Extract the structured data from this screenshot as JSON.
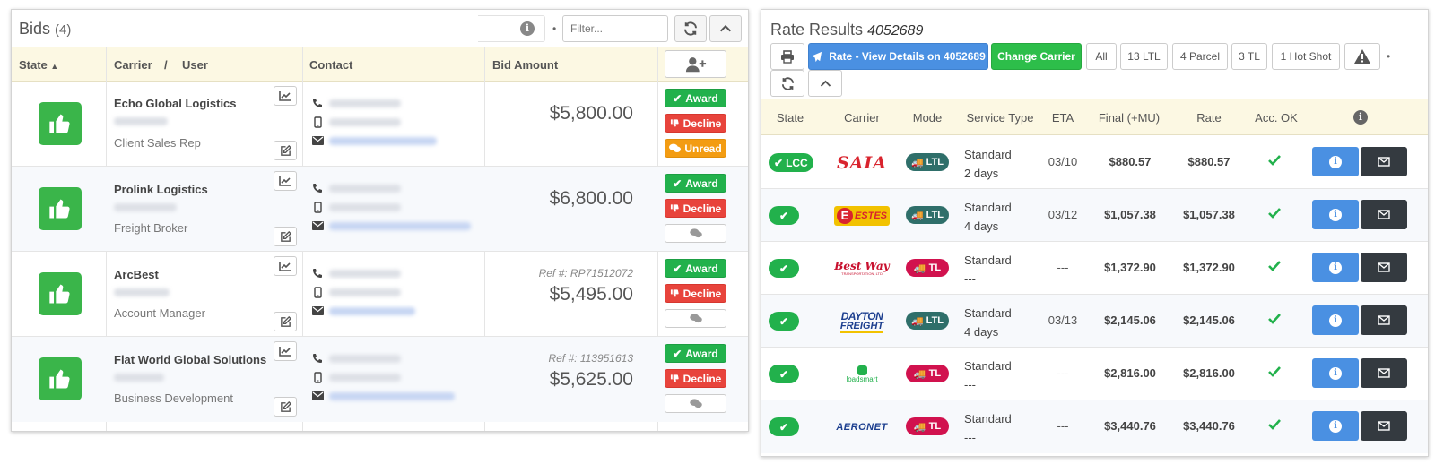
{
  "bids": {
    "title": "Bids",
    "count": "(4)",
    "filter_placeholder": "Filter...",
    "columns": {
      "state": "State",
      "carrier": "Carrier",
      "separator": "/",
      "user": "User",
      "contact": "Contact",
      "bid_amount": "Bid Amount"
    },
    "rows": [
      {
        "carrier": "Echo Global Logistics",
        "role": "Client Sales Rep",
        "ref": "",
        "amount": "$5,800.00",
        "actions": [
          "Award",
          "Decline",
          "Unread"
        ]
      },
      {
        "carrier": "Prolink Logistics",
        "role": "Freight Broker",
        "ref": "",
        "amount": "$6,800.00",
        "actions": [
          "Award",
          "Decline"
        ]
      },
      {
        "carrier": "ArcBest",
        "role": "Account Manager",
        "ref": "Ref #: RP71512072",
        "amount": "$5,495.00",
        "actions": [
          "Award",
          "Decline"
        ]
      },
      {
        "carrier": "Flat World Global Solutions",
        "role": "Business Development",
        "ref": "Ref #: 113951613",
        "amount": "$5,625.00",
        "actions": [
          "Award",
          "Decline"
        ]
      }
    ]
  },
  "rates": {
    "title": "Rate Results",
    "quote_id": "4052689",
    "buttons": {
      "view_details": "Rate - View Details on 4052689",
      "change_carrier": "Change Carrier",
      "filters": [
        "All",
        "13 LTL",
        "4 Parcel",
        "3 TL",
        "1 Hot Shot"
      ]
    },
    "columns": {
      "state": "State",
      "carrier": "Carrier",
      "mode": "Mode",
      "service_type": "Service Type",
      "eta": "ETA",
      "final": "Final (+MU)",
      "rate": "Rate",
      "acc_ok": "Acc. OK"
    },
    "rows": [
      {
        "state": "LCC",
        "carrier": "SAIA",
        "mode": "LTL",
        "service": "Standard",
        "days": "2 days",
        "eta": "03/10",
        "final": "$880.57",
        "rate": "$880.57"
      },
      {
        "state": "",
        "carrier": "ESTES",
        "mode": "LTL",
        "service": "Standard",
        "days": "4 days",
        "eta": "03/12",
        "final": "$1,057.38",
        "rate": "$1,057.38"
      },
      {
        "state": "",
        "carrier": "Best Way",
        "carrier_sub": "TRANSPORTATION, LTD",
        "mode": "TL",
        "service": "Standard",
        "days": "---",
        "eta": "---",
        "final": "$1,372.90",
        "rate": "$1,372.90"
      },
      {
        "state": "",
        "carrier": "DAYTON",
        "carrier_sub": "FREIGHT",
        "mode": "LTL",
        "service": "Standard",
        "days": "4 days",
        "eta": "03/13",
        "final": "$2,145.06",
        "rate": "$2,145.06"
      },
      {
        "state": "",
        "carrier": "loadsmart",
        "mode": "TL",
        "service": "Standard",
        "days": "---",
        "eta": "---",
        "final": "$2,816.00",
        "rate": "$2,816.00"
      },
      {
        "state": "",
        "carrier": "AERONET",
        "mode": "TL",
        "service": "Standard",
        "days": "---",
        "eta": "---",
        "final": "$3,440.76",
        "rate": "$3,440.76"
      }
    ]
  },
  "colors": {
    "green": "#22b14c",
    "red": "#e8443c",
    "orange": "#f39c12",
    "blue": "#4a90e2",
    "dark": "#343a40",
    "ltl": "#2f6f6a",
    "tl": "#d1124e",
    "header_bg": "#fcf8e3"
  }
}
